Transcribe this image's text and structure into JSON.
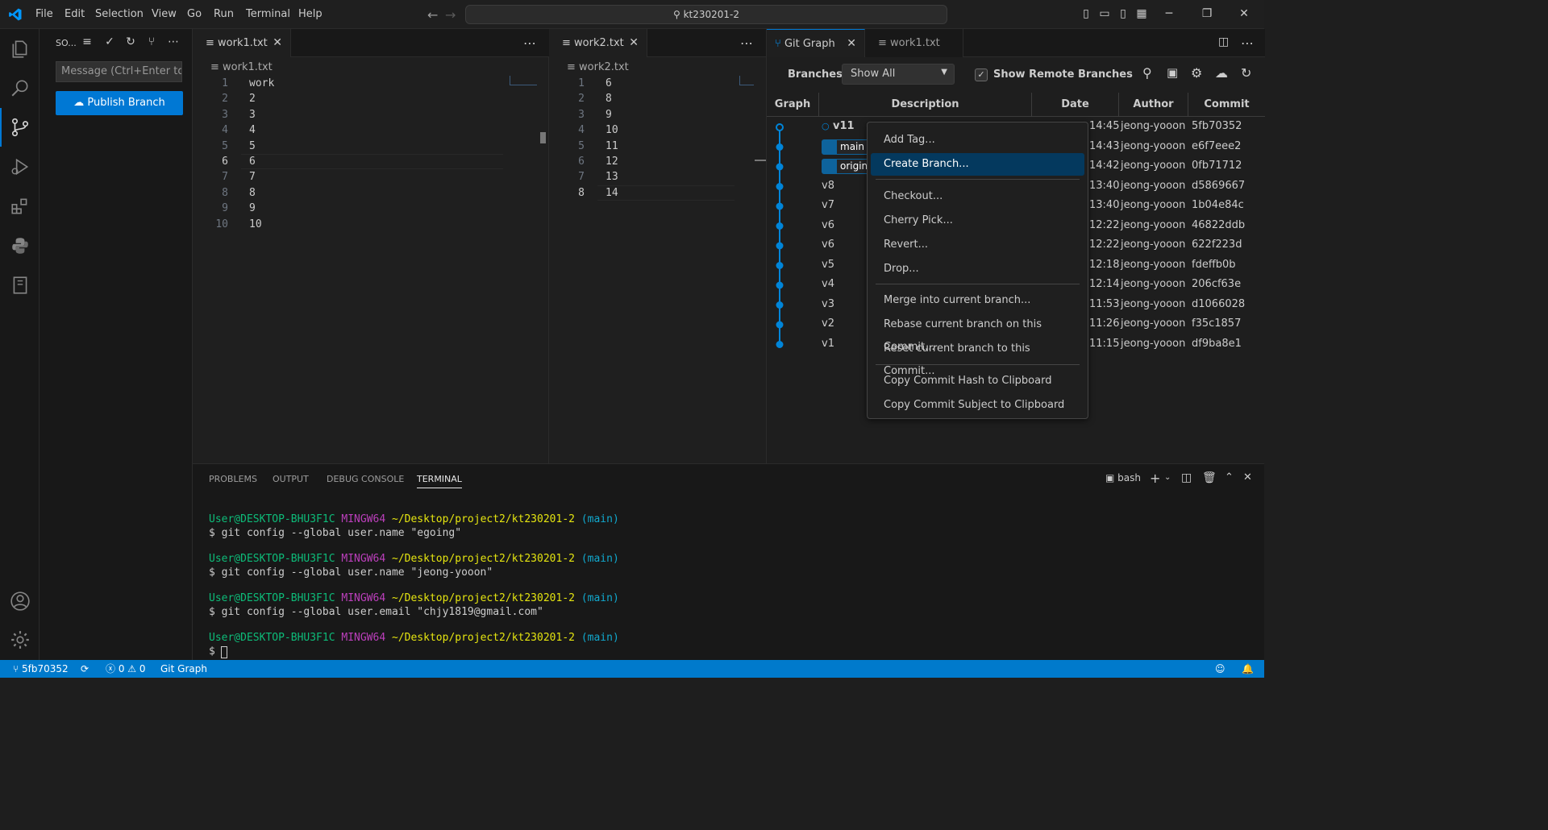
{
  "menu": [
    "File",
    "Edit",
    "Selection",
    "View",
    "Go",
    "Run",
    "Terminal",
    "Help"
  ],
  "command_center": "kt230201-2",
  "sidebar": {
    "title": "SO...",
    "commit_placeholder": "Message (Ctrl+Enter to...",
    "publish_label": "Publish Branch"
  },
  "editor1": {
    "tab": "work1.txt",
    "breadcrumb": "work1.txt",
    "lines": [
      "work",
      "2",
      "3",
      "4",
      "5",
      "6",
      "7",
      "8",
      "9",
      "10"
    ],
    "line_numbers": [
      "1",
      "2",
      "3",
      "4",
      "5",
      "6",
      "7",
      "8",
      "9",
      "10"
    ],
    "current_line": 6
  },
  "editor2": {
    "tab": "work2.txt",
    "breadcrumb": "work2.txt",
    "lines": [
      "6",
      "8",
      "9",
      "10",
      "11",
      "12",
      "13",
      "14"
    ],
    "line_numbers": [
      "1",
      "2",
      "3",
      "4",
      "5",
      "6",
      "7",
      "8"
    ],
    "current_line": 8
  },
  "gitgraph": {
    "tab": "Git Graph",
    "tab2": "work1.txt",
    "branches_label": "Branches:",
    "branches_value": "Show All",
    "show_remote_label": "Show Remote Branches",
    "columns": [
      "Graph",
      "Description",
      "Date",
      "Author",
      "Commit"
    ],
    "rows": [
      {
        "desc": "v11",
        "date": "14:45",
        "author": "jeong-yooon",
        "commit": "5fb70352"
      },
      {
        "desc": "main",
        "date": "14:43",
        "author": "jeong-yooon",
        "commit": "e6f7eee2"
      },
      {
        "desc": "origin/",
        "date": "14:42",
        "author": "jeong-yooon",
        "commit": "0fb71712"
      },
      {
        "desc": "v8",
        "date": "13:40",
        "author": "jeong-yooon",
        "commit": "d5869667"
      },
      {
        "desc": "v7",
        "date": "13:40",
        "author": "jeong-yooon",
        "commit": "1b04e84c"
      },
      {
        "desc": "v6",
        "date": "12:22",
        "author": "jeong-yooon",
        "commit": "46822ddb"
      },
      {
        "desc": "v6",
        "date": "12:22",
        "author": "jeong-yooon",
        "commit": "622f223d"
      },
      {
        "desc": "v5",
        "date": "12:18",
        "author": "jeong-yooon",
        "commit": "fdeffb0b"
      },
      {
        "desc": "v4",
        "date": "12:14",
        "author": "jeong-yooon",
        "commit": "206cf63e"
      },
      {
        "desc": "v3",
        "date": "11:53",
        "author": "jeong-yooon",
        "commit": "d1066028"
      },
      {
        "desc": "v2",
        "date": "11:26",
        "author": "jeong-yooon",
        "commit": "f35c1857"
      },
      {
        "desc": "v1",
        "date": "11:15",
        "author": "jeong-yooon",
        "commit": "df9ba8e1"
      }
    ]
  },
  "context_menu": {
    "items": [
      "Add Tag...",
      "Create Branch...",
      "Checkout...",
      "Cherry Pick...",
      "Revert...",
      "Drop...",
      "Merge into current branch...",
      "Rebase current branch on this Commit...",
      "Reset current branch to this Commit...",
      "Copy Commit Hash to Clipboard",
      "Copy Commit Subject to Clipboard"
    ],
    "selected": "Create Branch..."
  },
  "panel": {
    "tabs": [
      "PROBLEMS",
      "OUTPUT",
      "DEBUG CONSOLE",
      "TERMINAL"
    ],
    "active_tab": "TERMINAL",
    "shell": "bash",
    "terminal": {
      "user": "User@DESKTOP-BHU3F1C",
      "env": "MINGW64",
      "path": "~/Desktop/project2/kt230201-2",
      "branch": "(main)",
      "commands": [
        "$ git config --global user.name \"egoing\"",
        "$ git config --global user.name \"jeong-yooon\"",
        "$ git config --global user.email \"chjy1819@gmail.com\"",
        "$ "
      ]
    }
  },
  "statusbar": {
    "branch": "5fb70352",
    "errors": "0",
    "warnings": "0",
    "git_graph": "Git Graph"
  },
  "colors": {
    "accent": "#007acc",
    "graph_line": "#0085d9",
    "menu_selected": "#04395e"
  }
}
